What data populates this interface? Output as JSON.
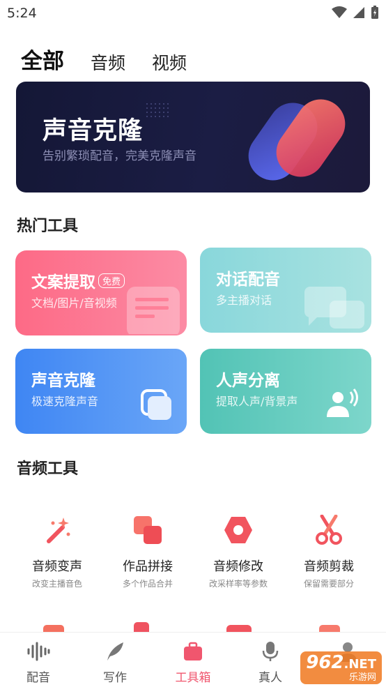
{
  "status_bar": {
    "time": "5:24"
  },
  "tabs": [
    {
      "label": "全部",
      "active": true
    },
    {
      "label": "音频",
      "active": false
    },
    {
      "label": "视频",
      "active": false
    }
  ],
  "banner": {
    "title": "声音克隆",
    "subtitle": "告别繁琐配音，完美克隆声音"
  },
  "hot_tools": {
    "title": "热门工具",
    "cards": [
      {
        "title": "文案提取",
        "badge": "免费",
        "subtitle": "文档/图片/音视频",
        "color": "#fb6f8e"
      },
      {
        "title": "对话配音",
        "subtitle": "多主播对话",
        "color": "#86d6d8"
      },
      {
        "title": "声音克隆",
        "subtitle": "极速克隆声音",
        "color": "#4d8ef5"
      },
      {
        "title": "人声分离",
        "subtitle": "提取人声/背景声",
        "color": "#5cc9b8"
      }
    ]
  },
  "audio_tools": {
    "title": "音频工具",
    "items": [
      {
        "title": "音频变声",
        "subtitle": "改变主播音色",
        "icon": "magic-wand-icon"
      },
      {
        "title": "作品拼接",
        "subtitle": "多个作品合并",
        "icon": "merge-squares-icon"
      },
      {
        "title": "音频修改",
        "subtitle": "改采样率等参数",
        "icon": "hexagon-nut-icon"
      },
      {
        "title": "音频剪裁",
        "subtitle": "保留需要部分",
        "icon": "scissors-icon"
      }
    ]
  },
  "nav": [
    {
      "label": "配音",
      "icon": "waveform-icon",
      "active": false
    },
    {
      "label": "写作",
      "icon": "feather-icon",
      "active": false
    },
    {
      "label": "工具箱",
      "icon": "toolbox-icon",
      "active": true
    },
    {
      "label": "真人",
      "icon": "microphone-icon",
      "active": false
    },
    {
      "label": "",
      "icon": "user-icon",
      "active": false
    }
  ],
  "watermark": {
    "brand": "962",
    "suffix": ".NET",
    "site": "乐游网"
  },
  "colors": {
    "accent": "#f0566e",
    "banner_bg": "#161838"
  }
}
